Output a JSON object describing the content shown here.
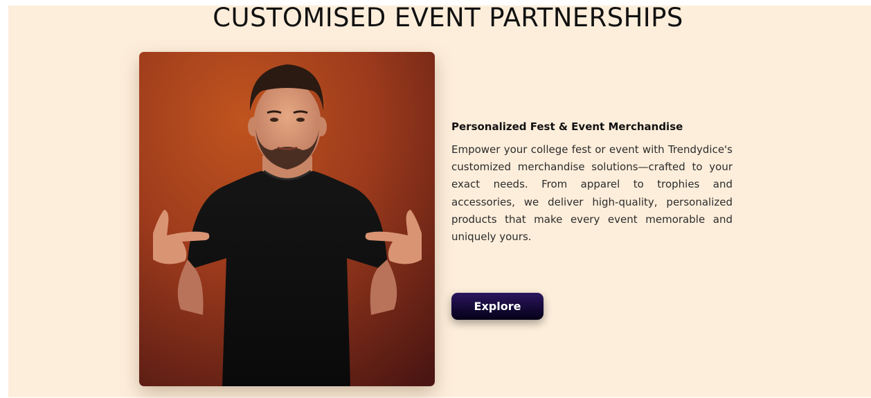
{
  "section": {
    "title": "CUSTOMISED EVENT PARTNERSHIPS"
  },
  "feature": {
    "image_icon": "photo-person-pointing-at-tshirt",
    "subtitle": "Personalized Fest & Event Merchandise",
    "description": "Empower your college fest or event with Trendydice's customized merchandise solutions—crafted to your exact needs. From apparel to trophies and accessories, we deliver high-quality, personalized products that make every event memorable and uniquely yours.",
    "cta_label": "Explore"
  },
  "colors": {
    "section_background": "#fdeedb",
    "button_gradient_top": "#2a165e",
    "button_gradient_bottom": "#050018",
    "photo_background": "#a8401d"
  }
}
